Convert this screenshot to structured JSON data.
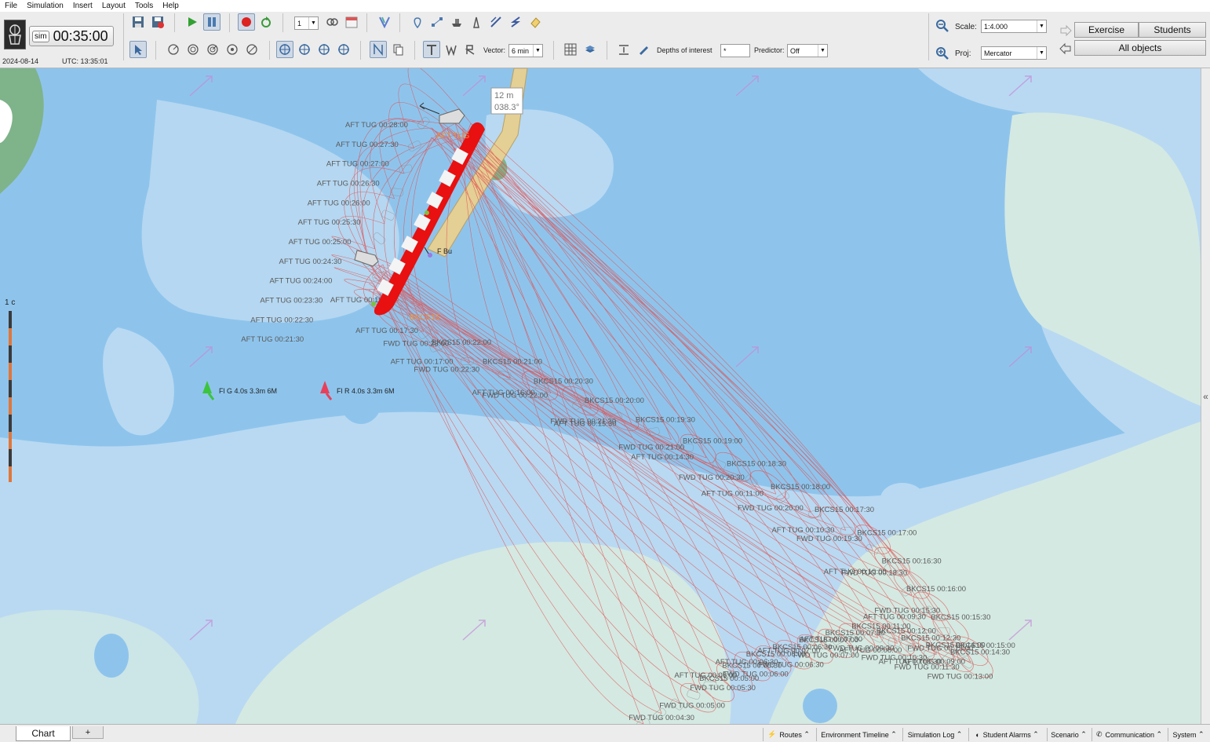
{
  "menu": [
    "File",
    "Simulation",
    "Insert",
    "Layout",
    "Tools",
    "Help"
  ],
  "clock": {
    "badge": "sim",
    "time": "00:35:00",
    "date": "2024-08-14",
    "utc": "UTC: 13:35:01"
  },
  "toolbar": {
    "speed_value": "1",
    "vector_label": "Vector:",
    "vector_value": "6 min",
    "depths_label": "Depths of interest",
    "depths_value": "*",
    "predictor_label": "Predictor:",
    "predictor_value": "Off",
    "scale_label": "Scale:",
    "scale_value": "1:4.000",
    "proj_label": "Proj:",
    "proj_value": "Mercator"
  },
  "right_panel": {
    "exercise": "Exercise",
    "students": "Students",
    "all_objects": "All objects"
  },
  "map": {
    "scale_bar_label": "1 c",
    "bearing_box": {
      "line1": "12 m",
      "line2": "038.3°"
    },
    "buoys": [
      {
        "label": "Fl G 4.0s 3.3m 6M",
        "color": "#3cc43c"
      },
      {
        "label": "Fl R 4.0s 3.3m 6M",
        "color": "#e8405a"
      }
    ],
    "small_label": "F Bu",
    "vessel_labels": [
      "AFT TUG",
      "BKCS15"
    ],
    "track_labels": [
      {
        "t": "AFT TUG 00:28:00"
      },
      {
        "t": "AFT TUG 00:27:30"
      },
      {
        "t": "AFT TUG 00:27:00"
      },
      {
        "t": "AFT TUG 00:26:30"
      },
      {
        "t": "AFT TUG 00:26:00"
      },
      {
        "t": "AFT TUG 00:25:30"
      },
      {
        "t": "AFT TUG 00:25:00"
      },
      {
        "t": "AFT TUG 00:24:30"
      },
      {
        "t": "AFT TUG 00:24:00"
      },
      {
        "t": "AFT TUG 00:23:30"
      },
      {
        "t": "AFT TUG 00:22:30"
      },
      {
        "t": "AFT TUG 00:21:30"
      },
      {
        "t": "AFT TUG 00:19:00"
      },
      {
        "t": "AFT TUG 00:17:30"
      },
      {
        "t": "AFT TUG 00:17:00"
      },
      {
        "t": "AFT TUG 00:16:00"
      },
      {
        "t": "AFT TUG 00:15:30"
      },
      {
        "t": "AFT TUG 00:14:30"
      },
      {
        "t": "AFT TUG 00:11:00"
      },
      {
        "t": "AFT TUG 00:10:30"
      },
      {
        "t": "AFT TUG 00:10:00"
      },
      {
        "t": "AFT TUG 00:09:30"
      },
      {
        "t": "AFT TUG 00:09:00"
      },
      {
        "t": "AFT TUG 00:08:30"
      },
      {
        "t": "AFT TUG 00:08:00"
      },
      {
        "t": "AFT TUG 00:07:30"
      },
      {
        "t": "AFT TUG 00:07:00"
      },
      {
        "t": "AFT TUG 00:06:30"
      },
      {
        "t": "AFT TUG 00:06:00"
      },
      {
        "t": "BKCS15 00:22:00"
      },
      {
        "t": "BKCS15 00:21:00"
      },
      {
        "t": "BKCS15 00:20:30"
      },
      {
        "t": "BKCS15 00:20:00"
      },
      {
        "t": "BKCS15 00:19:30"
      },
      {
        "t": "BKCS15 00:19:00"
      },
      {
        "t": "BKCS15 00:18:30"
      },
      {
        "t": "BKCS15 00:18:00"
      },
      {
        "t": "BKCS15 00:17:30"
      },
      {
        "t": "BKCS15 00:17:00"
      },
      {
        "t": "BKCS15 00:16:30"
      },
      {
        "t": "BKCS15 00:16:00"
      },
      {
        "t": "BKCS15 00:15:30"
      },
      {
        "t": "BKCS15 00:15:00"
      },
      {
        "t": "BKCS15 00:14:30"
      },
      {
        "t": "BKCS15 00:14:00"
      },
      {
        "t": "BKCS15 00:12:30"
      },
      {
        "t": "BKCS15 00:12:00"
      },
      {
        "t": "BKCS15 00:11:00"
      },
      {
        "t": "BKCS15 00:07:30"
      },
      {
        "t": "BKCS15 00:07:00"
      },
      {
        "t": "BKCS15 00:06:30"
      },
      {
        "t": "BKCS15 00:06:00"
      },
      {
        "t": "BKCS15 00:05:30"
      },
      {
        "t": "BKCS15 00:05:00"
      },
      {
        "t": "FWD TUG 00:23:00"
      },
      {
        "t": "FWD TUG 00:22:30"
      },
      {
        "t": "FWD TUG 00:22:00"
      },
      {
        "t": "FWD TUG 00:21:30"
      },
      {
        "t": "FWD TUG 00:21:00"
      },
      {
        "t": "FWD TUG 00:20:30"
      },
      {
        "t": "FWD TUG 00:20:00"
      },
      {
        "t": "FWD TUG 00:19:30"
      },
      {
        "t": "FWD TUG 00:18:30"
      },
      {
        "t": "FWD TUG 00:15:30"
      },
      {
        "t": "FWD TUG 00:15:00"
      },
      {
        "t": "FWD TUG 00:13:00"
      },
      {
        "t": "FWD TUG 00:11:30"
      },
      {
        "t": "FWD TUG 00:10:30"
      },
      {
        "t": "FWD TUG 00:09:30"
      },
      {
        "t": "FWD TUG 00:07:00"
      },
      {
        "t": "FWD TUG 00:06:30"
      },
      {
        "t": "FWD TUG 00:06:00"
      },
      {
        "t": "FWD TUG 00:05:30"
      },
      {
        "t": "FWD TUG 00:05:00"
      },
      {
        "t": "FWD TUG 00:04:30"
      }
    ]
  },
  "tabs": {
    "chart": "Chart",
    "add": "+"
  },
  "panels": [
    "Routes",
    "Environment Timeline",
    "Simulation Log",
    "Student Alarms",
    "Scenario",
    "Communication",
    "System"
  ]
}
